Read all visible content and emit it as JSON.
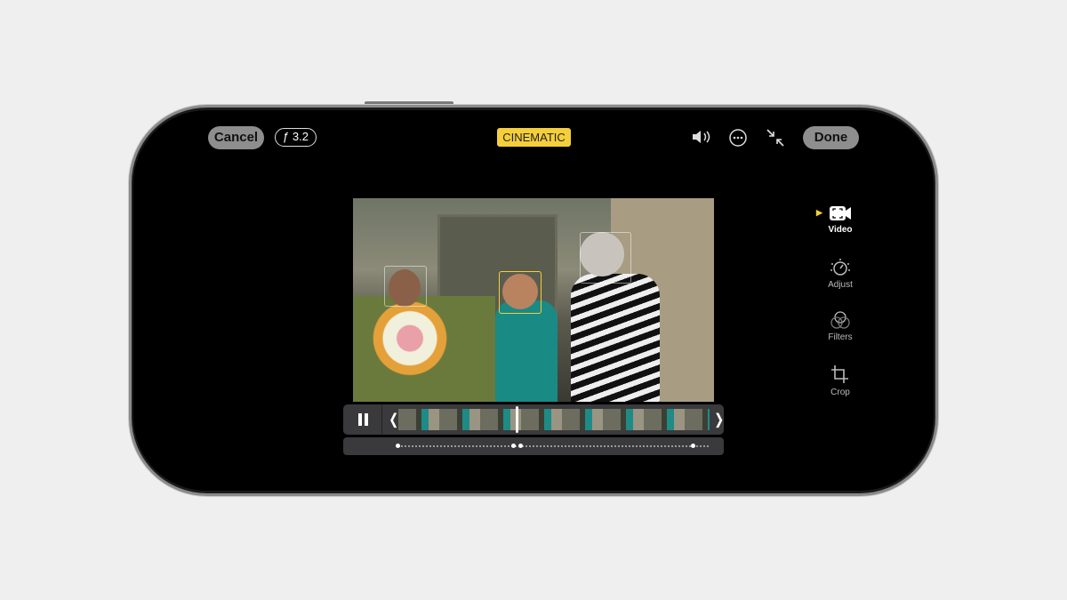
{
  "toolbar": {
    "cancel_label": "Cancel",
    "aperture_label": "ƒ 3.2",
    "mode_badge": "CINEMATIC",
    "done_label": "Done",
    "icons": [
      "speaker-icon",
      "more-icon",
      "collapse-icon"
    ],
    "accent": "#f5cf3b"
  },
  "sidebar": {
    "items": [
      {
        "label": "Video",
        "icon": "video-camera-icon",
        "active": true
      },
      {
        "label": "Adjust",
        "icon": "adjust-dial-icon"
      },
      {
        "label": "Filters",
        "icon": "filters-icon"
      },
      {
        "label": "Crop",
        "icon": "crop-icon"
      }
    ]
  },
  "playback": {
    "state": "playing",
    "playhead_fraction": 0.41
  }
}
